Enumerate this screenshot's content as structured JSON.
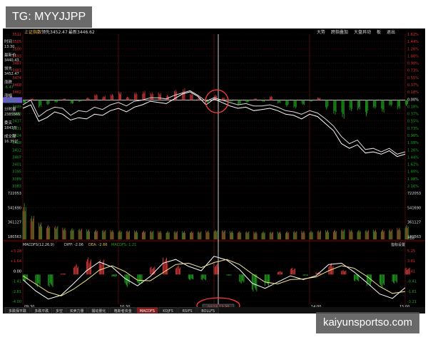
{
  "watermarks": {
    "top": "TG: MYYJJPP",
    "bottom": "kaiyunsportso.com"
  },
  "header": {
    "index_name": "上证指数",
    "lead_label": "领先",
    "lead_value": "3452.47",
    "latest_label": "最新",
    "latest_value": "3446.62",
    "right_buttons": [
      "大势",
      "跨指叠加",
      "大盘异动",
      "板",
      "退出"
    ]
  },
  "info_panel": {
    "items": [
      {
        "label": "时间",
        "value": "13:30"
      },
      {
        "label": "最新价",
        "value": "3440.43"
      },
      {
        "label": "领先",
        "value": "3452.47"
      },
      {
        "label": "涨跌",
        "value": "-6.47"
      },
      {
        "label": "涨幅",
        "value": "-0.37%"
      },
      {
        "label": "分时量",
        "value": "2385565"
      },
      {
        "label": "委买",
        "value": "1843万"
      },
      {
        "label": "成交额",
        "value": "16.35亿"
      }
    ]
  },
  "crosshair_time": "04/18 13:30",
  "colors": {
    "up": "#d73a3a",
    "down": "#1fa51f",
    "price_line": "#ffffff",
    "lead_line": "#f0e68c",
    "base_line": "#6a5acd",
    "grid": "#5a1010",
    "circle": "#ff3b3b",
    "axis_text_left": "#e03030",
    "axis_text_right": "#e03030"
  },
  "chart_data": [
    {
      "type": "line",
      "title": "",
      "xlabel": "",
      "ylabel": "",
      "x_ticks": [
        "09:30",
        "10:30",
        "11:30",
        "14:00",
        "15:00"
      ],
      "x_range": [
        0,
        240
      ],
      "ylim": [
        3383,
        3512
      ],
      "prev_close": 3456,
      "y_ticks_left": [
        "3512",
        "3505",
        "3500",
        "3493",
        "3487",
        "3481",
        "3474",
        "3468",
        "3462",
        "3456",
        "3449",
        "3443",
        "3437",
        "3431",
        "3424",
        "3418",
        "3412",
        "3407",
        "3401",
        "3395",
        "3389",
        "3383"
      ],
      "y_ticks_right": [
        "1.62%",
        "1.44%",
        "1.26%",
        "1.08%",
        "0.90%",
        "0.73%",
        "0.55%",
        "0.37%",
        "0.18%",
        "0.00%",
        "0.18%",
        "0.37%",
        "0.55%",
        "0.73%",
        "0.90%",
        "1.08%",
        "1.26%",
        "1.44%",
        "1.62%",
        "1.80%",
        "1.98%",
        "2.16%"
      ],
      "series": [
        {
          "x": [
            0,
            5,
            10,
            15,
            20,
            25,
            30,
            35,
            40,
            45,
            50,
            55,
            60,
            65,
            70,
            75,
            80,
            85,
            90,
            95,
            100,
            105,
            110,
            115,
            120,
            125,
            130,
            135,
            140,
            145,
            150,
            155,
            160,
            165,
            170,
            175,
            180,
            185,
            190,
            195,
            200,
            205,
            210,
            215,
            220,
            225,
            230,
            235,
            240
          ],
          "values": [
            3449,
            3452,
            3438,
            3441,
            3446,
            3444,
            3439,
            3441,
            3440,
            3444,
            3443,
            3447,
            3449,
            3446,
            3450,
            3452,
            3455,
            3454,
            3453,
            3457,
            3461,
            3463,
            3459,
            3452,
            3457,
            3454,
            3451,
            3449,
            3450,
            3447,
            3448,
            3449,
            3447,
            3444,
            3443,
            3440,
            3444,
            3442,
            3436,
            3430,
            3419,
            3415,
            3418,
            3411,
            3412,
            3410,
            3413,
            3408,
            3410
          ]
        },
        {
          "x": [
            0,
            5,
            10,
            15,
            20,
            25,
            30,
            35,
            40,
            45,
            50,
            55,
            60,
            65,
            70,
            75,
            80,
            85,
            90,
            95,
            100,
            105,
            110,
            115,
            120,
            125,
            130,
            135,
            140,
            145,
            150,
            155,
            160,
            165,
            170,
            175,
            180,
            185,
            190,
            195,
            200,
            205,
            210,
            215,
            220,
            225,
            230,
            235,
            240
          ],
          "values": [
            3452,
            3456,
            3442,
            3447,
            3450,
            3449,
            3443,
            3447,
            3446,
            3450,
            3448,
            3452,
            3454,
            3451,
            3455,
            3456,
            3458,
            3458,
            3457,
            3460,
            3462,
            3464,
            3460,
            3455,
            3458,
            3456,
            3454,
            3452,
            3453,
            3451,
            3451,
            3452,
            3450,
            3447,
            3446,
            3444,
            3447,
            3445,
            3440,
            3434,
            3425,
            3419,
            3422,
            3414,
            3415,
            3412,
            3415,
            3410,
            3412
          ]
        }
      ],
      "histogram": {
        "x": [
          0,
          5,
          10,
          15,
          20,
          25,
          30,
          35,
          40,
          45,
          50,
          55,
          60,
          65,
          70,
          75,
          80,
          85,
          90,
          95,
          100,
          105,
          110,
          115,
          120,
          125,
          130,
          135,
          140,
          145,
          150,
          155,
          160,
          165,
          170,
          175,
          180,
          185,
          190,
          195,
          200,
          205,
          210,
          215,
          220,
          225,
          230,
          235,
          240
        ],
        "values": [
          -4,
          2,
          -9,
          -6,
          -3,
          2,
          -5,
          -2,
          3,
          7,
          5,
          8,
          10,
          4,
          9,
          11,
          10,
          9,
          6,
          12,
          14,
          9,
          4,
          -3,
          6,
          3,
          -2,
          -6,
          -3,
          2,
          -2,
          5,
          -4,
          -8,
          -10,
          -6,
          -2,
          3,
          -11,
          -17,
          -22,
          -14,
          -12,
          -19,
          -10,
          -15,
          -8,
          -11,
          -7
        ]
      },
      "volume_ticks_left": [
        "722053",
        "541690",
        "361127",
        "180563"
      ],
      "volume_ticks_right": [
        "722053",
        "541690",
        "361127",
        "180563",
        "X10"
      ],
      "volume": {
        "x": [
          0,
          5,
          10,
          15,
          20,
          25,
          30,
          35,
          40,
          45,
          50,
          55,
          60,
          65,
          70,
          75,
          80,
          85,
          90,
          95,
          100,
          105,
          110,
          115,
          120,
          125,
          130,
          135,
          140,
          145,
          150,
          155,
          160,
          165,
          170,
          175,
          180,
          185,
          190,
          195,
          200,
          205,
          210,
          215,
          220,
          225,
          230,
          235,
          240
        ],
        "values": [
          650000,
          420000,
          300000,
          260000,
          240000,
          210000,
          200000,
          190000,
          180000,
          175000,
          170000,
          168000,
          165000,
          160000,
          160000,
          158000,
          156000,
          152000,
          150000,
          150000,
          148000,
          146000,
          145000,
          160000,
          175000,
          165000,
          150000,
          148000,
          145000,
          140000,
          142000,
          138000,
          140000,
          145000,
          150000,
          152000,
          155000,
          160000,
          165000,
          170000,
          180000,
          175000,
          170000,
          168000,
          172000,
          176000,
          180000,
          210000,
          260000
        ]
      }
    },
    {
      "type": "line",
      "title": "MACD",
      "xlabel": "",
      "ylabel": "",
      "legend": [
        "MACDFS(12,26,9)",
        "DIFF: -2.06",
        "DEA: -2.66",
        "MACDFS: 1.21"
      ],
      "y_ticks_left": [
        "+3.28",
        "+1.64",
        "0.00",
        "-1.41",
        "-2.81",
        "-4.00"
      ],
      "y_ticks_right": [
        "5.25",
        "3.81",
        "2.41",
        "-0.41",
        "-1.81",
        "-3.21"
      ],
      "ylim": [
        -4.5,
        4.0
      ],
      "x_range": [
        0,
        240
      ],
      "series": [
        {
          "name": "DIFF",
          "x": [
            0,
            8,
            16,
            24,
            32,
            40,
            48,
            56,
            64,
            72,
            80,
            88,
            96,
            104,
            112,
            120,
            128,
            136,
            144,
            152,
            160,
            168,
            176,
            184,
            192,
            200,
            208,
            216,
            224,
            232,
            240
          ],
          "values": [
            -0.8,
            -2.6,
            -3.9,
            -3.3,
            -1.4,
            0.6,
            2.0,
            1.2,
            -0.6,
            -1.8,
            -0.3,
            1.8,
            2.4,
            1.3,
            0.6,
            2.9,
            2.3,
            0.8,
            -1.4,
            -2.2,
            -1.2,
            -0.2,
            -0.8,
            -0.2,
            1.6,
            1.8,
            0.4,
            -1.3,
            -3.1,
            -3.8,
            -2.1
          ]
        },
        {
          "name": "DEA",
          "x": [
            0,
            8,
            16,
            24,
            32,
            40,
            48,
            56,
            64,
            72,
            80,
            88,
            96,
            104,
            112,
            120,
            128,
            136,
            144,
            152,
            160,
            168,
            176,
            184,
            192,
            200,
            208,
            216,
            224,
            232,
            240
          ],
          "values": [
            -0.2,
            -1.5,
            -2.8,
            -3.4,
            -2.3,
            -0.9,
            0.7,
            1.4,
            0.5,
            -0.9,
            -1.0,
            0.3,
            1.6,
            1.8,
            1.1,
            1.9,
            2.4,
            1.6,
            0.1,
            -1.2,
            -1.5,
            -0.8,
            -0.7,
            -0.4,
            0.6,
            1.4,
            1.0,
            -0.3,
            -1.9,
            -3.0,
            -2.7
          ]
        }
      ],
      "histogram": {
        "x": [
          0,
          8,
          16,
          24,
          32,
          40,
          48,
          56,
          64,
          72,
          80,
          88,
          96,
          104,
          112,
          120,
          128,
          136,
          144,
          152,
          160,
          168,
          176,
          184,
          192,
          200,
          208,
          216,
          224,
          232,
          240
        ],
        "values": [
          -1.2,
          -2.2,
          -2.2,
          0.2,
          1.8,
          3.0,
          2.6,
          -0.4,
          -2.2,
          -1.8,
          1.4,
          3.0,
          1.6,
          -1.0,
          -1.0,
          2.0,
          -0.2,
          -1.6,
          -3.0,
          -2.0,
          0.6,
          1.2,
          -0.2,
          0.4,
          2.0,
          0.8,
          -1.2,
          -2.0,
          -2.4,
          -1.6,
          1.21
        ]
      }
    }
  ],
  "bottom_tabs": [
    "多跌保平跌",
    "多跌平跌",
    "多空",
    "买卖力量",
    "摆动量化",
    "格斯者资金",
    "MACDFS",
    "KDJFS",
    "RSIFS",
    "BOLLFS"
  ],
  "macd_header_right": "指标设置"
}
